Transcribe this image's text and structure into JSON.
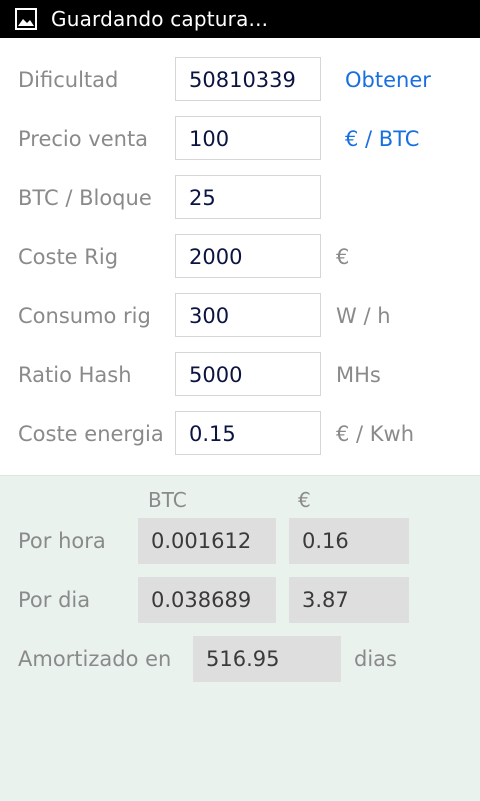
{
  "status_bar": {
    "icon": "image-icon",
    "title": "Guardando captura..."
  },
  "form": {
    "rows": [
      {
        "label": "Dificultad",
        "value": "50810339",
        "action": "Obtener"
      },
      {
        "label": "Precio venta",
        "value": "100",
        "action": "€ / BTC"
      },
      {
        "label": "BTC / Bloque",
        "value": "25"
      },
      {
        "label": "Coste Rig",
        "value": "2000",
        "unit": "€"
      },
      {
        "label": "Consumo rig",
        "value": "300",
        "unit": "W / h"
      },
      {
        "label": "Ratio Hash",
        "value": "5000",
        "unit": "MHs"
      },
      {
        "label": "Coste energia",
        "value": "0.15",
        "unit": "€ / Kwh"
      }
    ]
  },
  "results": {
    "col_btc": "BTC",
    "col_eur": "€",
    "per_hour": {
      "label": "Por hora",
      "btc": "0.001612",
      "eur": "0.16"
    },
    "per_day": {
      "label": "Por dia",
      "btc": "0.038689",
      "eur": "3.87"
    },
    "amortized": {
      "label": "Amortizado en",
      "value": "516.95",
      "unit": "dias"
    }
  }
}
